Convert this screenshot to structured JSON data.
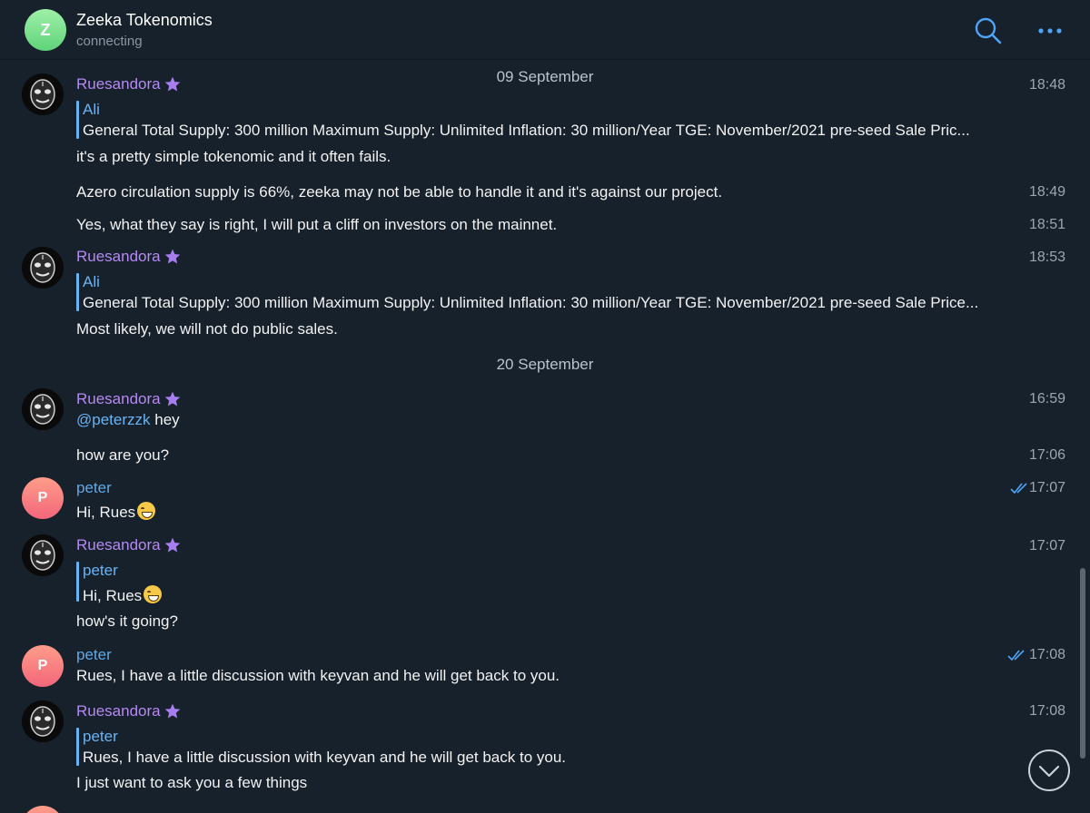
{
  "header": {
    "avatar_letter": "Z",
    "title": "Zeeka Tokenomics",
    "status": "connecting",
    "icons": [
      "search-icon",
      "more-icon"
    ]
  },
  "date_separators": [
    "09 September",
    "20 September"
  ],
  "messages": [
    {
      "sender": "Ruesandora",
      "time": "18:48",
      "reply": {
        "name": "Ali",
        "text": "General Total Supply: 300 million Maximum Supply: Unlimited Inflation: 30 million/Year TGE: November/2021  pre-seed Sale Pric..."
      },
      "text": "it's a pretty simple tokenomic and it often fails."
    },
    {
      "sender": "Ruesandora",
      "time": "18:49",
      "text": "Azero circulation supply is 66%, zeeka may not be able to handle it and it's against our project."
    },
    {
      "sender": "Ruesandora",
      "time": "18:51",
      "text": "Yes, what they say is right, I will put a cliff on investors on the mainnet."
    },
    {
      "sender": "Ruesandora",
      "time": "18:53",
      "reply": {
        "name": "Ali",
        "text": "General Total Supply: 300 million Maximum Supply: Unlimited Inflation: 30 million/Year TGE: November/2021  pre-seed Sale Price..."
      },
      "text": "Most likely, we will not do public sales."
    },
    {
      "sender": "Ruesandora",
      "time": "16:59",
      "mention": "@peterzzk",
      "text": " hey"
    },
    {
      "sender": "Ruesandora",
      "time": "17:06",
      "text": "how are you?"
    },
    {
      "sender": "peter",
      "avatar_letter": "P",
      "time": "17:07",
      "text": "Hi, Rues",
      "read": true
    },
    {
      "sender": "Ruesandora",
      "time": "17:07",
      "reply": {
        "name": "peter",
        "text": "Hi, Rues"
      },
      "text": "how's it going?"
    },
    {
      "sender": "peter",
      "avatar_letter": "P",
      "time": "17:08",
      "text": "Rues, I have a little discussion with keyvan and he will get back to you.",
      "read": true
    },
    {
      "sender": "Ruesandora",
      "time": "17:08",
      "reply": {
        "name": "peter",
        "text": "Rues, I have a little discussion with keyvan and he will get back to you."
      },
      "text": "I just want to ask you a few things"
    }
  ],
  "colors": {
    "background": "#17212b",
    "rues_name": "#b589f2",
    "peter_name": "#61a9e8",
    "reply_accent": "#6ab3f3",
    "timestamp": "#9aa6b2"
  }
}
